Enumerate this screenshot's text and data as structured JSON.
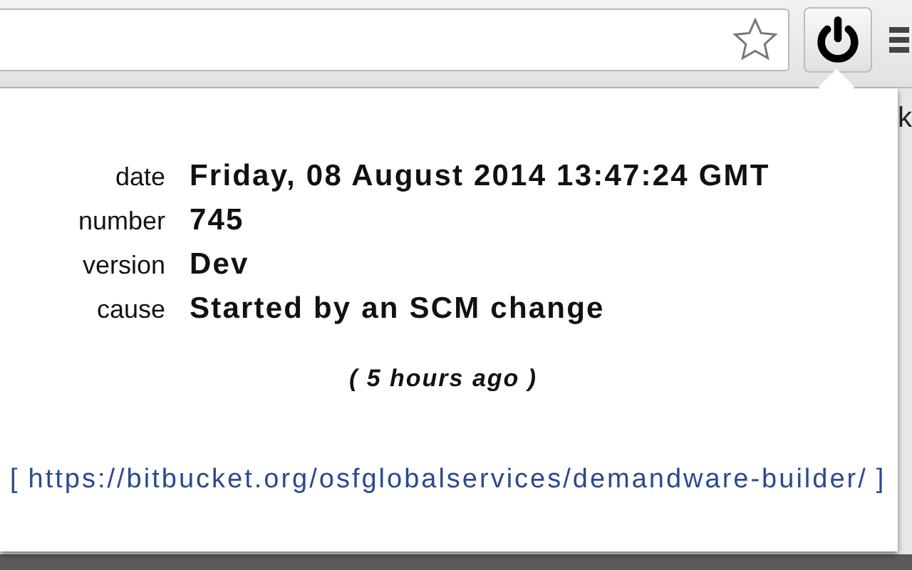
{
  "page_fragment": "k",
  "details": [
    {
      "label": "date",
      "value": "Friday, 08 August 2014 13:47:24 GMT"
    },
    {
      "label": "number",
      "value": "745"
    },
    {
      "label": "version",
      "value": "Dev"
    },
    {
      "label": "cause",
      "value": "Started by an SCM change"
    }
  ],
  "relative_time": "( 5 hours ago )",
  "link": {
    "open": "[",
    "url": "https://bitbucket.org/osfglobalservices/demandware-builder/",
    "close": "]"
  }
}
